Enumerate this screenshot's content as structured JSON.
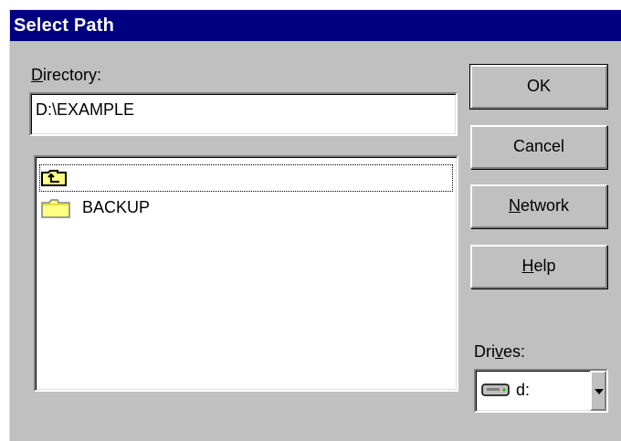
{
  "window": {
    "title": "Select Path"
  },
  "directory": {
    "label_accel": "D",
    "label_rest": "irectory:",
    "value": "D:\\EXAMPLE"
  },
  "folder_list": {
    "items": [
      {
        "label": "",
        "icon": "folder-up-icon",
        "focused": true
      },
      {
        "label": "BACKUP",
        "icon": "folder-icon",
        "focused": false
      }
    ]
  },
  "buttons": {
    "ok": "OK",
    "cancel": "Cancel",
    "network_accel": "N",
    "network_rest": "etwork",
    "help_accel": "H",
    "help_rest": "elp"
  },
  "drives": {
    "label_pre": "Dri",
    "label_accel": "v",
    "label_post": "es:",
    "selected": "d:",
    "icon": "hard-drive-icon"
  },
  "colors": {
    "titlebar": "#000080",
    "face": "#c0c0c0",
    "folder": "#ffff80"
  }
}
